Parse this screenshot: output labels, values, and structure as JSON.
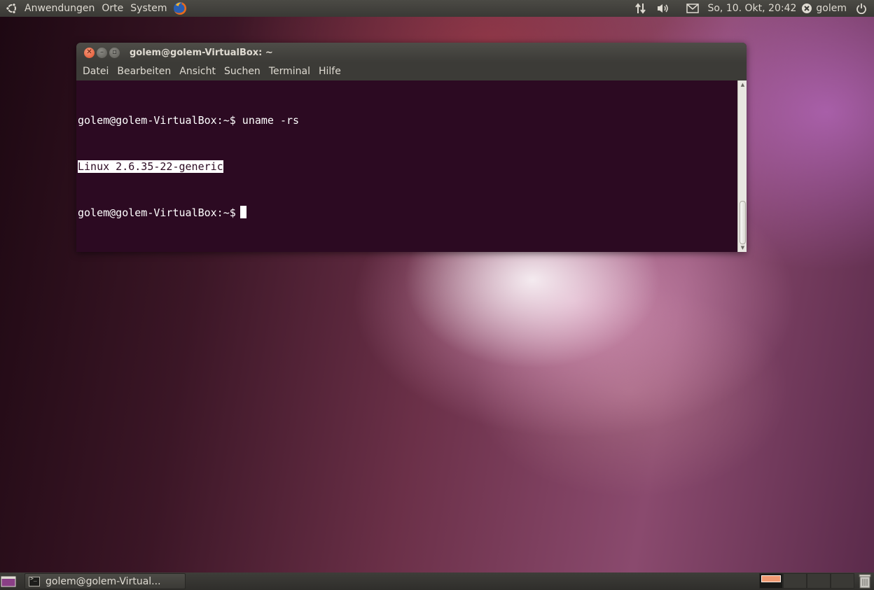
{
  "top_panel": {
    "menus": [
      "Anwendungen",
      "Orte",
      "System"
    ],
    "clock": "So, 10. Okt, 20:42",
    "user": "golem"
  },
  "terminal": {
    "title": "golem@golem-VirtualBox: ~",
    "menus": [
      "Datei",
      "Bearbeiten",
      "Ansicht",
      "Suchen",
      "Terminal",
      "Hilfe"
    ],
    "lines": {
      "line1": "golem@golem-VirtualBox:~$ uname -rs",
      "line2": "Linux 2.6.35-22-generic",
      "line3": "golem@golem-VirtualBox:~$"
    }
  },
  "taskbar": {
    "task_label": "golem@golem-Virtual..."
  },
  "colors": {
    "terminal_bg": "#2c0a22",
    "panel_bg": "#3c3b37",
    "close_button": "#e2502a"
  }
}
